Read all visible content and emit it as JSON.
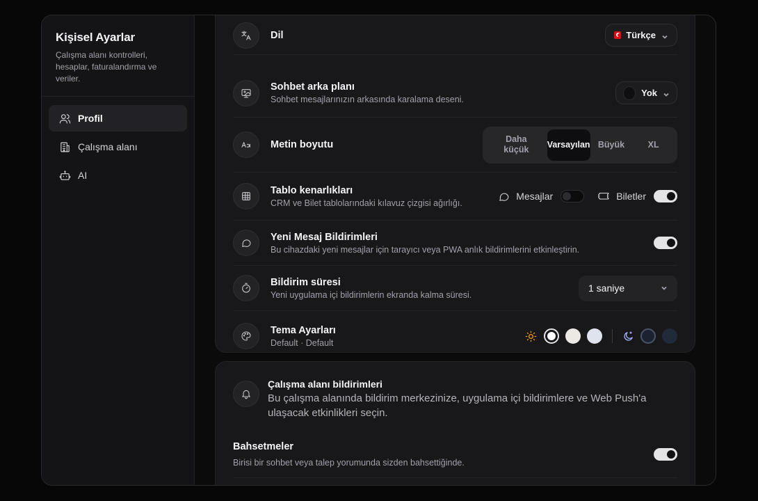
{
  "sidebar": {
    "title": "Kişisel Ayarlar",
    "description": "Çalışma alanı kontrolleri, hesaplar, faturalandırma ve veriler.",
    "items": [
      {
        "label": "Profil",
        "icon": "users-icon",
        "active": true
      },
      {
        "label": "Çalışma alanı",
        "icon": "building-icon",
        "active": false
      },
      {
        "label": "AI",
        "icon": "bot-icon",
        "active": false
      }
    ]
  },
  "settings": {
    "language": {
      "title": "Dil",
      "value": "Türkçe",
      "icon": "translate-icon"
    },
    "chat_background": {
      "title": "Sohbet arka planı",
      "subtitle": "Sohbet mesajlarınızın arkasında karalama deseni.",
      "value": "Yok"
    },
    "text_size": {
      "title": "Metin boyutu",
      "options": [
        "Daha küçük",
        "Varsayılan",
        "Büyük",
        "XL"
      ],
      "selected": "Varsayılan"
    },
    "table_borders": {
      "title": "Tablo kenarlıkları",
      "subtitle": "CRM ve Bilet tablolarındaki kılavuz çizgisi ağırlığı.",
      "messages_label": "Mesajlar",
      "messages_on": false,
      "tickets_label": "Biletler",
      "tickets_on": true
    },
    "new_message_notifications": {
      "title": "Yeni Mesaj Bildirimleri",
      "subtitle": "Bu cihazdaki yeni mesajlar için tarayıcı veya PWA anlık bildirimlerini etkinleştirin.",
      "on": true
    },
    "notification_duration": {
      "title": "Bildirim süresi",
      "subtitle": "Yeni uygulama içi bildirimlerin ekranda kalma süresi.",
      "value": "1 saniye"
    },
    "theme": {
      "title": "Tema Ayarları",
      "subtitle": "Default · Default",
      "light_colors": [
        "#ffffff",
        "#ece9e4",
        "#dfe3ee"
      ],
      "dark_colors": [
        "#1c2230",
        "#212a38"
      ]
    }
  },
  "workspace_notifications": {
    "title": "Çalışma alanı bildirimleri",
    "description": "Bu çalışma alanında bildirim merkezinize, uygulama içi bildirimlere ve Web Push'a ulaşacak etkinlikleri seçin.",
    "mentions": {
      "title": "Bahsetmeler",
      "subtitle": "Birisi bir sohbet veya talep yorumunda sizden bahsettiğinde.",
      "on": true
    }
  },
  "colors": {
    "accent_sun": "#f59e0b",
    "accent_moon": "#a5b4fc"
  }
}
